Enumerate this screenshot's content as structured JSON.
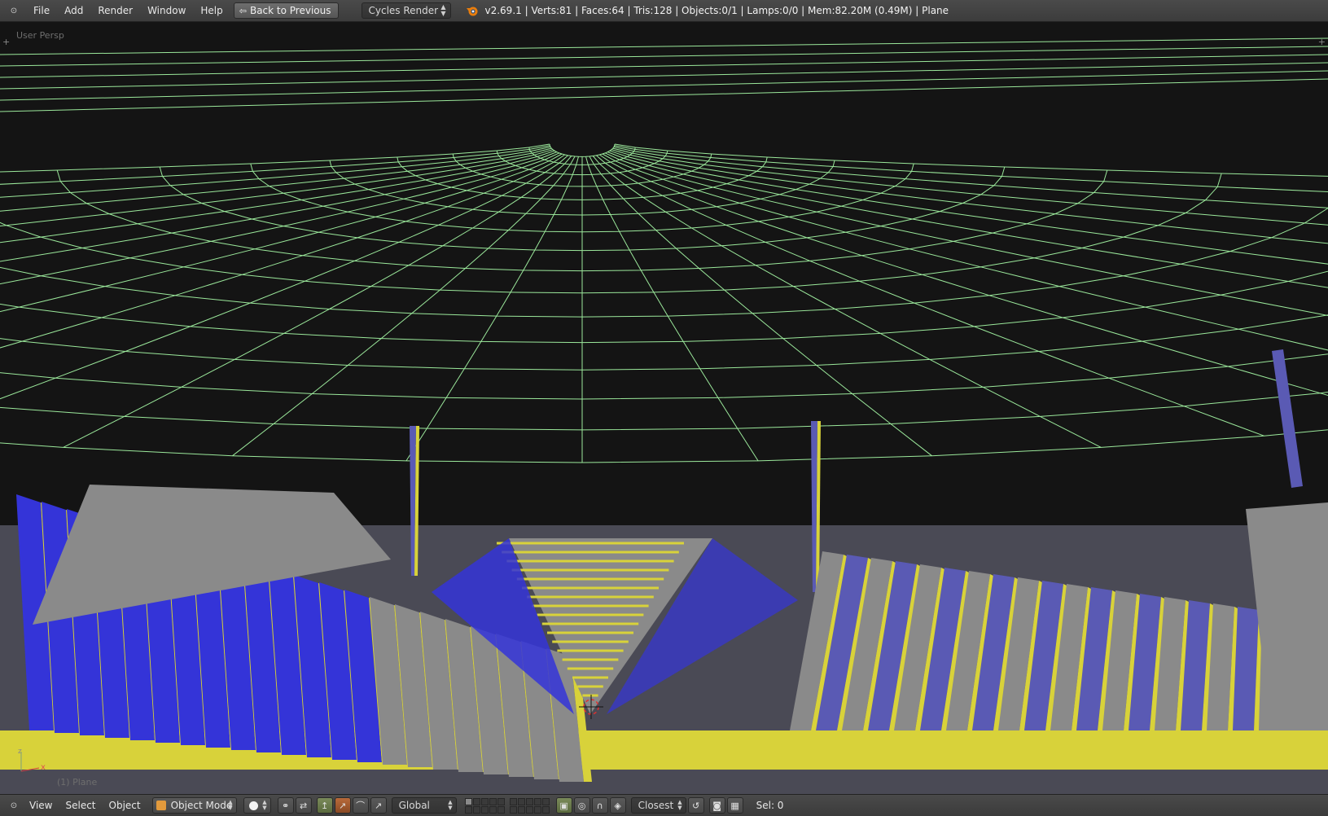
{
  "top_header": {
    "menu": [
      "File",
      "Add",
      "Render",
      "Window",
      "Help"
    ],
    "back_button": "Back to Previous",
    "render_engine": "Cycles Render",
    "stats": "v2.69.1 | Verts:81 | Faces:64 | Tris:128 | Objects:0/1 | Lamps:0/0 | Mem:82.20M (0.49M) | Plane"
  },
  "viewport": {
    "view_name": "User Persp",
    "object_name": "(1) Plane",
    "axis_x": "x",
    "axis_z": "z",
    "colors": {
      "background": "#141414",
      "wire": "#9be89b",
      "yellow": "#d8d23a",
      "blue": "#3434d8",
      "periwinkle": "#5a5ab4",
      "gray": "#8a8a8a",
      "horizon": "#4a4a55"
    }
  },
  "bottom_header": {
    "menu": [
      "View",
      "Select",
      "Object"
    ],
    "mode": "Object Mode",
    "orientation": "Global",
    "snap_target": "Closest",
    "selection": "Sel: 0",
    "icons": [
      "viewport-shading-icon",
      "pivot-icon",
      "manipulator-icon",
      "translate-icon",
      "rotate-icon",
      "scale-icon",
      "layers-icon",
      "lock-camera-icon",
      "proportional-edit-icon",
      "snap-icon",
      "snap-element-icon",
      "snap-rotate-icon",
      "render-still-icon",
      "render-anim-icon"
    ]
  }
}
